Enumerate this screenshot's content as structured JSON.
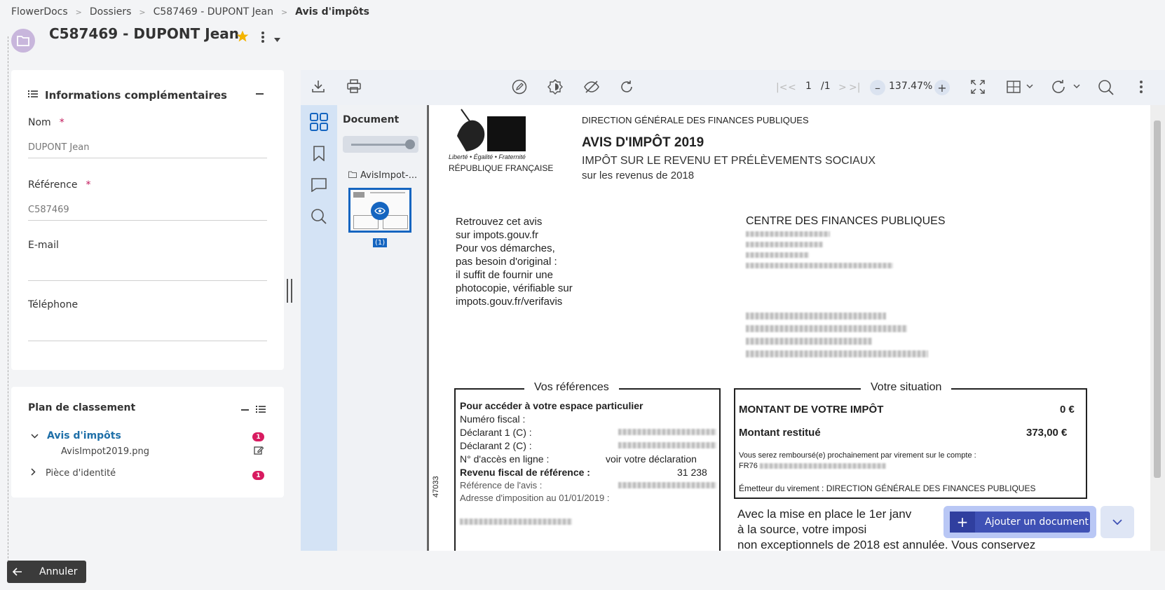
{
  "breadcrumb": {
    "items": [
      "FlowerDocs",
      "Dossiers",
      "C587469 - DUPONT Jean",
      "Avis d'impôts"
    ]
  },
  "page": {
    "title": "C587469 - DUPONT Jean"
  },
  "info_card": {
    "title": "Informations complémentaires",
    "fields": [
      {
        "label": "Nom",
        "required": "*",
        "value": "DUPONT Jean"
      },
      {
        "label": "Référence",
        "required": "*",
        "value": "C587469"
      },
      {
        "label": "E-mail",
        "value": ""
      },
      {
        "label": "Téléphone",
        "value": ""
      }
    ]
  },
  "plan_card": {
    "title": "Plan de classement",
    "items": [
      {
        "label": "Avis d'impôts",
        "badge": "1",
        "children": [
          {
            "label": "AvisImpot2019.png"
          }
        ]
      },
      {
        "label": "Pièce d'identité",
        "badge": "1"
      }
    ]
  },
  "viewer": {
    "page_current": "1",
    "page_total": "/1",
    "zoom": "137.47%",
    "thumbs_title": "Document",
    "file_name": "AvisImpot-...",
    "thumb_page": "(1)"
  },
  "document": {
    "header_right": "DIRECTION GÉNÉRALE DES FINANCES PUBLIQUES",
    "title": "AVIS D'IMPÔT 2019",
    "subtitle": "IMPÔT SUR LE REVENU ET PRÉLÈVEMENTS SOCIAUX",
    "subtitle2": "sur les revenus de 2018",
    "motto": "Liberté • Égalité • Fraternité",
    "republique": "RÉPUBLIQUE FRANÇAISE",
    "left_block": [
      "Retrouvez cet avis",
      "sur impots.gouv.fr",
      "Pour vos démarches,",
      "pas besoin d'original :",
      "il suffit de fournir une",
      "photocopie, vérifiable sur",
      "impots.gouv.fr/verifavis"
    ],
    "centre": "CENTRE DES FINANCES PUBLIQUES",
    "vos_references": {
      "title": "Vos références",
      "rows": [
        {
          "label": "Pour accéder à votre espace particulier",
          "value": ""
        },
        {
          "label": "Numéro fiscal  :",
          "value": ""
        },
        {
          "label": "Déclarant 1 (C) :",
          "value": ""
        },
        {
          "label": "Déclarant 2 (C) :",
          "value": ""
        },
        {
          "label": "N° d'accès en ligne :",
          "value": "voir votre déclaration"
        },
        {
          "label": "Revenu fiscal de référence :",
          "value": "31 238"
        },
        {
          "label": "Référence de l'avis :",
          "value": ""
        },
        {
          "label": "Adresse d'imposition au 01/01/2019 :",
          "value": ""
        }
      ]
    },
    "side_code": "47033",
    "votre_situation": {
      "title": "Votre situation",
      "montant_label": "MONTANT DE VOTRE IMPÔT",
      "montant_value": "0 €",
      "restitue_label": "Montant restitué",
      "restitue_value": "373,00 €",
      "rembourse": "Vous serez remboursé(e) prochainement par virement sur le compte :",
      "iban_prefix": "FR76",
      "emetteur": "Émetteur du virement : DIRECTION GÉNÉRALE DES FINANCES PUBLIQUES"
    },
    "bottom_lines": [
      "Avec la mise en place le 1er janv",
      "à  la  source,  votre  imposi",
      "non exceptionnels de 2018 est annulée. Vous conservez"
    ]
  },
  "actions": {
    "add_document": "Ajouter un document",
    "cancel": "Annuler"
  },
  "colors": {
    "accent": "#3f51b5",
    "badge": "#d81b60",
    "tree_active": "#1e6fa8",
    "star": "#f4b400"
  }
}
